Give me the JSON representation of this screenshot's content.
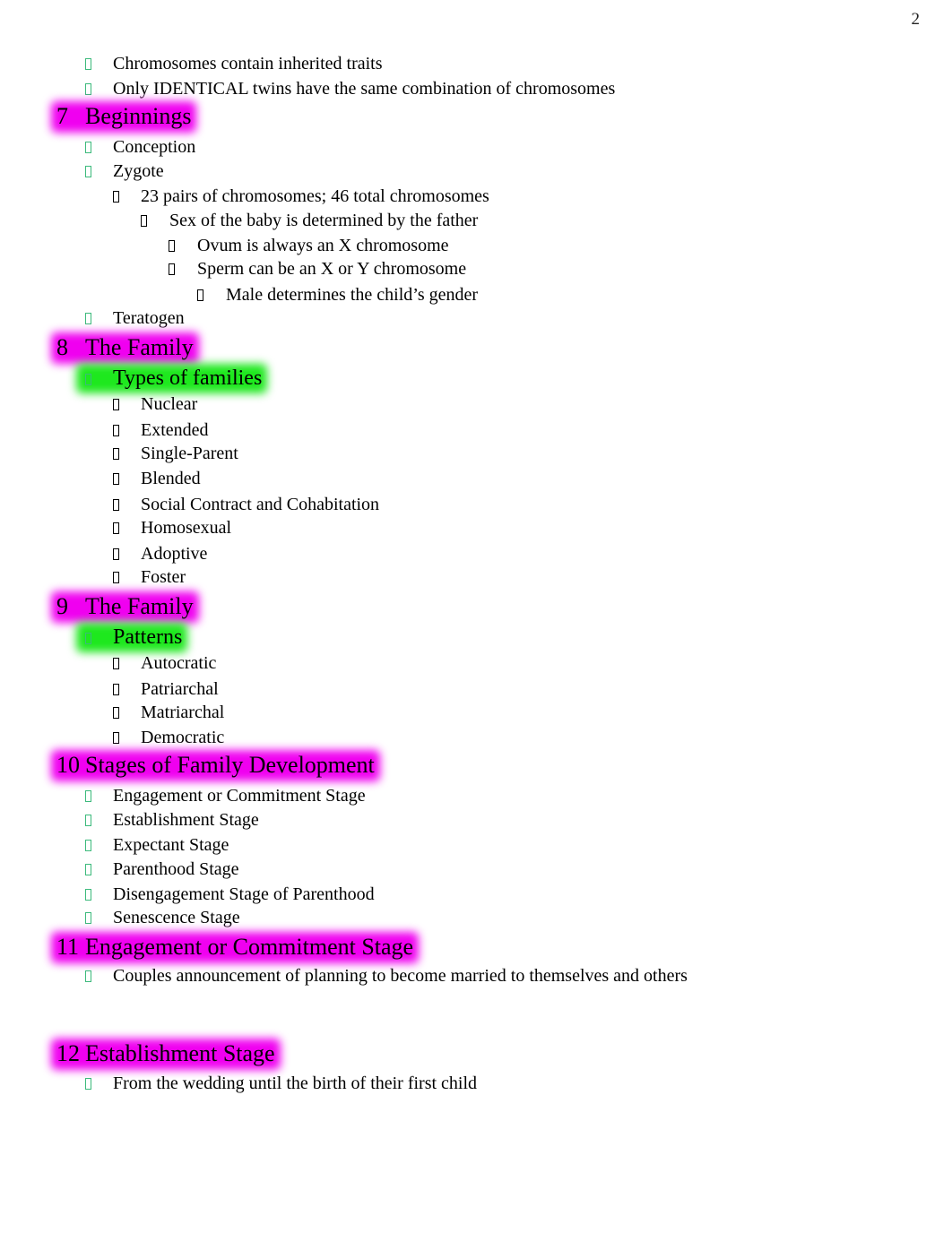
{
  "page": {
    "number": "2"
  },
  "colors": {
    "heading_highlight": "#f000f0",
    "subheading_highlight": "#1ee81e",
    "level1_bullet": "#3cba7c",
    "deep_bullet": "#000000"
  },
  "bullet_icon": "missing-glyph-box",
  "intro": [
    "Chromosomes contain inherited traits",
    "Only IDENTICAL twins have the same combination of chromosomes"
  ],
  "sections": [
    {
      "number": "7",
      "title": "Beginnings",
      "items": [
        "Conception",
        "Zygote",
        "23 pairs of chromosomes; 46 total chromosomes",
        "Sex of the baby is determined by the father",
        "Ovum is always an X chromosome",
        "Sperm can be an X or Y chromosome",
        "Male determines the child’s gender",
        "Teratogen"
      ]
    },
    {
      "number": "8",
      "title": "The Family",
      "subheading": "Types of families",
      "items": [
        "Nuclear",
        "Extended",
        "Single-Parent",
        "Blended",
        "Social Contract and Cohabitation",
        "Homosexual",
        "Adoptive",
        "Foster"
      ]
    },
    {
      "number": "9",
      "title": "The Family",
      "subheading": "Patterns",
      "items": [
        "Autocratic",
        "Patriarchal",
        "Matriarchal",
        "Democratic"
      ]
    },
    {
      "number": "10",
      "title": "Stages of Family Development",
      "items": [
        "Engagement or Commitment Stage",
        "Establishment Stage",
        "Expectant Stage",
        "Parenthood Stage",
        "Disengagement Stage of Parenthood",
        "Senescence Stage"
      ]
    },
    {
      "number": "11",
      "title": "Engagement or Commitment Stage",
      "items": [
        "Couples announcement of planning to become married to themselves and others"
      ]
    },
    {
      "number": "12",
      "title": "Establishment Stage",
      "items": [
        "From the wedding until the birth of their first child"
      ]
    }
  ]
}
